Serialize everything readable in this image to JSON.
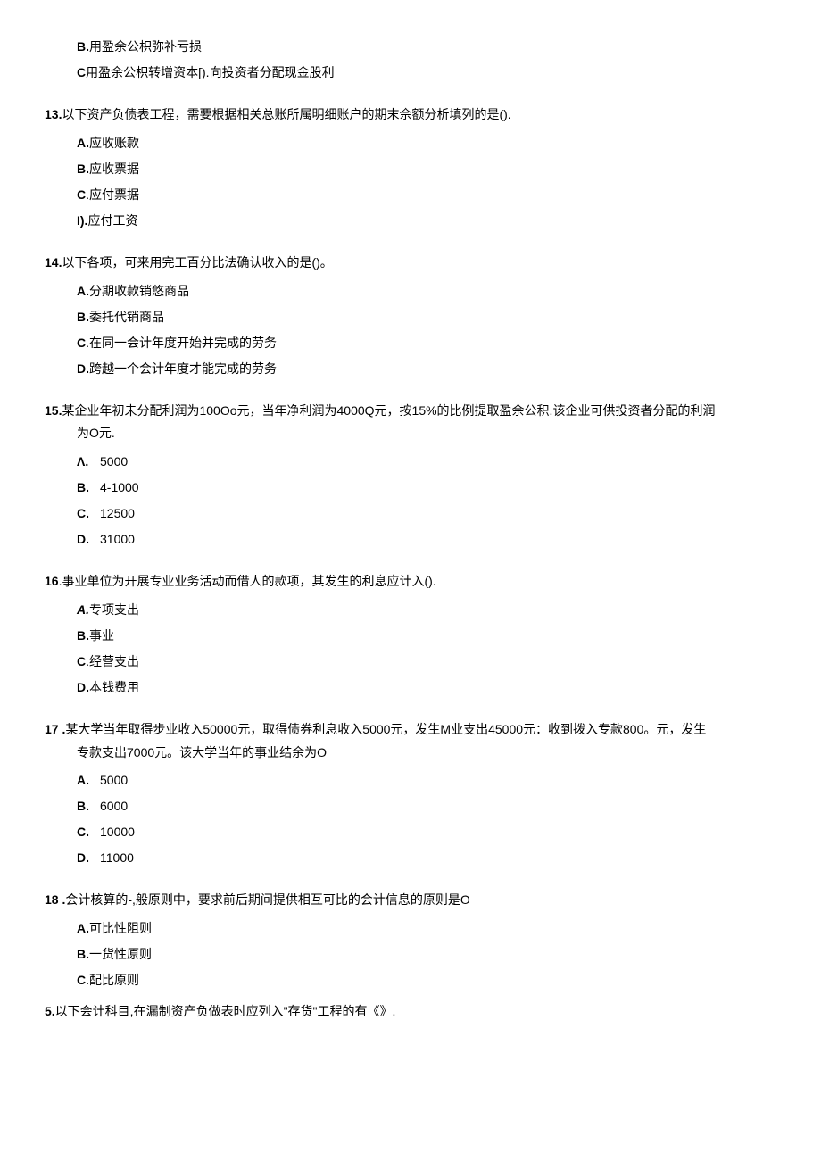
{
  "top_options": {
    "b": {
      "label": "B.",
      "text": "用盈余公枳弥补亏损"
    },
    "c": {
      "label": "C",
      "text": "用盈余公枳转增资本[).向投资者分配现金股利"
    }
  },
  "q13": {
    "num": "13.",
    "text": "以下资产负债表工程，需要根据相关总账所属明细账户的期末佘额分析填列的是().",
    "a": {
      "label": "A.",
      "text": "应收账款"
    },
    "b": {
      "label": "B.",
      "text": "应收票据"
    },
    "c": {
      "label": "C",
      "text": ".应付票据"
    },
    "d": {
      "label": "I).",
      "text": "应付工资"
    }
  },
  "q14": {
    "num": "14.",
    "text": "以下各项，可来用完工百分比法确认收入的是()。",
    "a": {
      "label": "A.",
      "text": "分期收款销悠商品"
    },
    "b": {
      "label": "B.",
      "text": "委托代销商品"
    },
    "c": {
      "label": "C",
      "text": ".在同一会计年度开始并完成的劳务"
    },
    "d": {
      "label": "D.",
      "text": "跨越一个会计年度才能完成的劳务"
    }
  },
  "q15": {
    "num": "15.",
    "text": "某企业年初未分配利润为100Oo元，当年净利润为4000Q元，按15%的比例提取盈余公积.该企业可供投资者分配的利润",
    "text2": "为O元.",
    "a": {
      "label": "Λ.",
      "text": "5000"
    },
    "b": {
      "label": "B.",
      "text": "4-1000"
    },
    "c": {
      "label": "C.",
      "text": "12500"
    },
    "d": {
      "label": "D.",
      "text": "31000"
    }
  },
  "q16": {
    "num": "16",
    "text": ".事业单位为开展专业业务活动而借人的款项，其发生的利息应计入().",
    "a": {
      "label": "A.",
      "text": "专项支出"
    },
    "b": {
      "label": "B.",
      "text": "事业"
    },
    "c": {
      "label": "C",
      "text": ".经营支出"
    },
    "d": {
      "label": "D.",
      "text": "本钱费用"
    }
  },
  "q17": {
    "num": "17 .",
    "text": "某大学当年取得步业收入50000元，取得债券利息收入5000元，发生M业支出45000元：收到拨入专款800。元，发生",
    "text2": "专款支出7000元。该大学当年的事业结余为O",
    "a": {
      "label": "A.",
      "text": "5000"
    },
    "b": {
      "label": "B.",
      "text": "6000"
    },
    "c": {
      "label": "C.",
      "text": "10000"
    },
    "d": {
      "label": "D.",
      "text": "11000"
    }
  },
  "q18": {
    "num": "18 .",
    "text": "会计核算的-,般原则中，要求前后期间提供相互可比的会计信息的原则是O",
    "a": {
      "label": "A.",
      "text": "可比性阻则"
    },
    "b": {
      "label": "B.",
      "text": "一货性原则"
    },
    "c": {
      "label": "C",
      "text": ".配比原则"
    }
  },
  "q5": {
    "num": "5.",
    "text": "以下会计科目,在漏制资产负做表时应列入\"存货\"工程的有《》."
  }
}
